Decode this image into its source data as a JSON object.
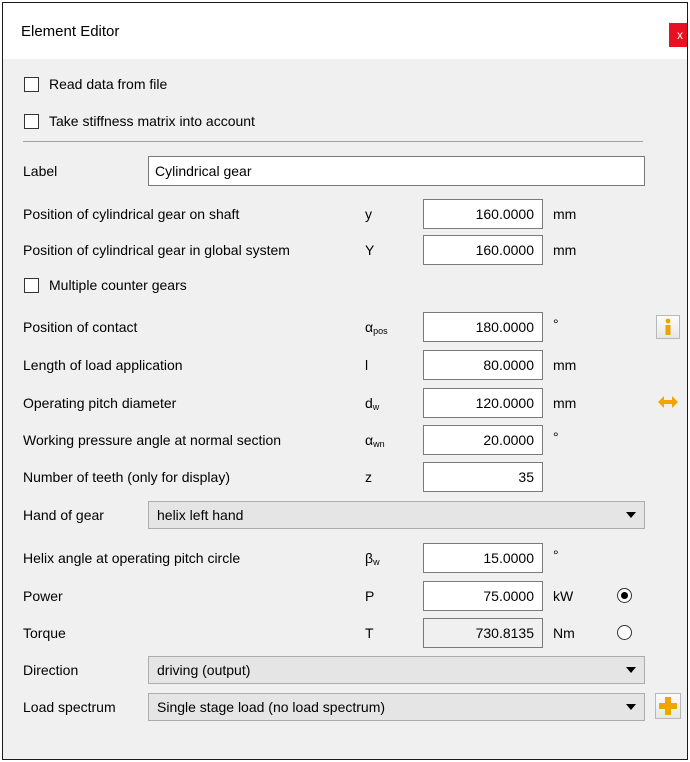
{
  "window": {
    "title": "Element Editor",
    "close_label": "x"
  },
  "checks": {
    "read_file": {
      "label": "Read data from file",
      "checked": false
    },
    "stiffness": {
      "label": "Take stiffness matrix into account",
      "checked": false
    },
    "multiple_counter": {
      "label": "Multiple counter gears",
      "checked": false
    }
  },
  "fields": {
    "label": {
      "label": "Label",
      "value": "Cylindrical gear"
    },
    "pos_shaft": {
      "label": "Position of cylindrical gear on shaft",
      "symbol": "y",
      "value": "160.0000",
      "unit": "mm"
    },
    "pos_global": {
      "label": "Position of cylindrical gear in global system",
      "symbol": "Y",
      "value": "160.0000",
      "unit": "mm"
    },
    "contact": {
      "label": "Position of contact",
      "symbol": "α",
      "symbol_sub": "pos",
      "value": "180.0000",
      "unit": "°"
    },
    "load_len": {
      "label": "Length of load application",
      "symbol": "l",
      "value": "80.0000",
      "unit": "mm"
    },
    "pitch_dia": {
      "label": "Operating pitch diameter",
      "symbol": "d",
      "symbol_sub": "w",
      "value": "120.0000",
      "unit": "mm"
    },
    "pressure": {
      "label": "Working pressure angle at normal section",
      "symbol": "α",
      "symbol_sub": "wn",
      "value": "20.0000",
      "unit": "°"
    },
    "teeth": {
      "label": "Number of teeth (only for display)",
      "symbol": "z",
      "value": "35"
    },
    "hand": {
      "label": "Hand of gear",
      "selected": "helix left hand"
    },
    "helix": {
      "label": "Helix angle at operating pitch circle",
      "symbol": "β",
      "symbol_sub": "w",
      "value": "15.0000",
      "unit": "°"
    },
    "power": {
      "label": "Power",
      "symbol": "P",
      "value": "75.0000",
      "unit": "kW",
      "selected": true
    },
    "torque": {
      "label": "Torque",
      "symbol": "T",
      "value": "730.8135",
      "unit": "Nm",
      "selected": false
    },
    "direction": {
      "label": "Direction",
      "selected": "driving (output)"
    },
    "load_spectrum": {
      "label": "Load spectrum",
      "selected": "Single stage load (no load spectrum)"
    }
  },
  "colors": {
    "close": "#e81123",
    "info_icon": "#e8a400",
    "plus_icon": "#f0a500"
  },
  "icons": {
    "info": "info-icon",
    "swap": "swap-arrows-icon",
    "add": "plus-icon"
  }
}
